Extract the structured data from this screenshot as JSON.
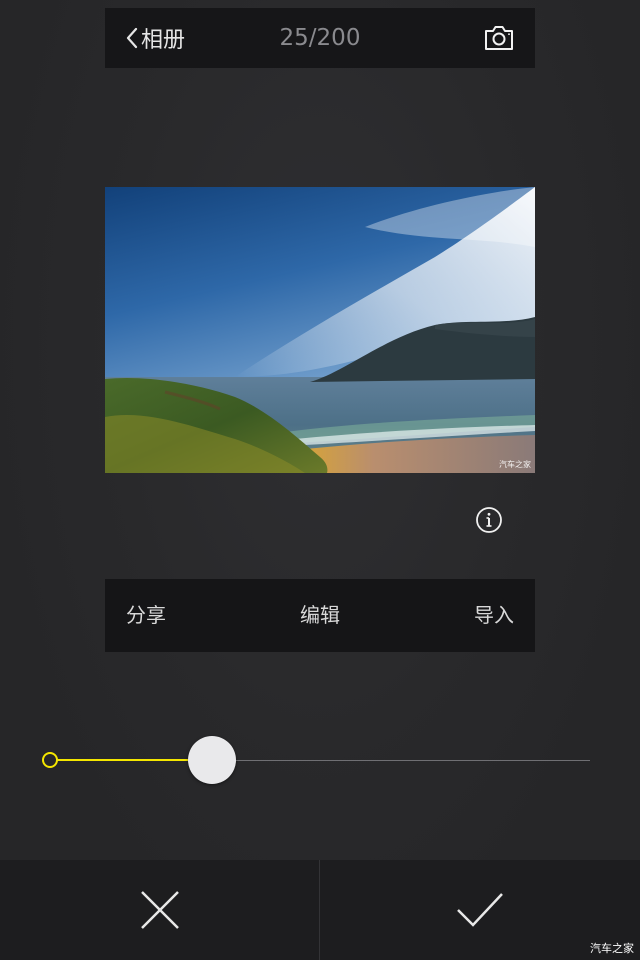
{
  "top_bar": {
    "back_label": "相册",
    "counter": "25/200",
    "back_icon": "chevron-left-icon",
    "camera_icon": "camera-icon"
  },
  "photo": {
    "watermark": "汽车之家"
  },
  "info_icon": "info-icon",
  "action_bar": {
    "share_label": "分享",
    "edit_label": "编辑",
    "import_label": "导入"
  },
  "slider": {
    "value_fraction": 0.3,
    "accent_color": "#f4e600"
  },
  "bottom_bar": {
    "cancel_icon": "close-icon",
    "confirm_icon": "checkmark-icon"
  },
  "corner_watermark": "汽车之家"
}
